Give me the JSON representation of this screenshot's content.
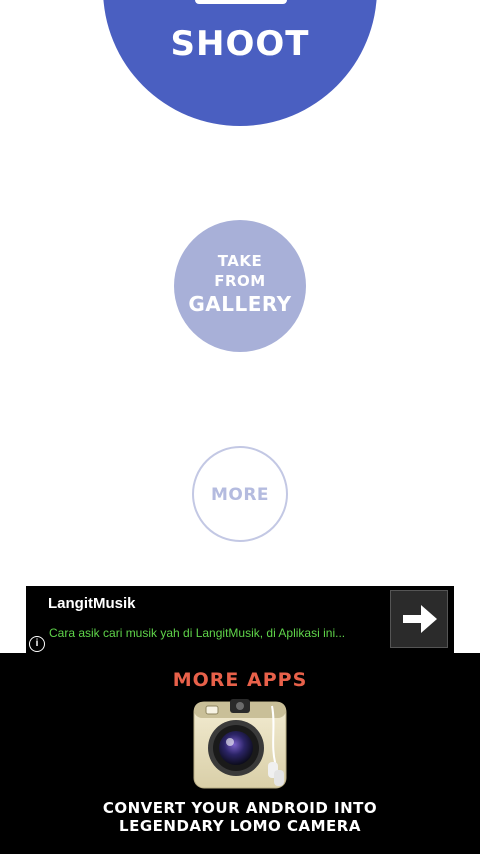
{
  "main": {
    "shoot_label": "SHOOT",
    "gallery": {
      "line1": "TAKE",
      "line2": "FROM",
      "line3": "GALLERY"
    },
    "more_label": "MORE"
  },
  "ad": {
    "title": "LangitMusik",
    "description": "Cara asik cari musik yah di LangitMusik, di Aplikasi ini...",
    "info_icon": "info-icon",
    "arrow_icon": "arrow-right-icon"
  },
  "more_apps": {
    "title": "MORE APPS",
    "app_icon": "lomo-camera-icon",
    "promo_line1": "CONVERT YOUR ANDROID INTO",
    "promo_line2": "LEGENDARY LOMO CAMERA"
  },
  "colors": {
    "primary": "#4a5fc1",
    "secondary": "#a8b0d8",
    "outline": "#c3c8e4",
    "ad_text": "#5fd44a",
    "accent": "#e8614a"
  }
}
